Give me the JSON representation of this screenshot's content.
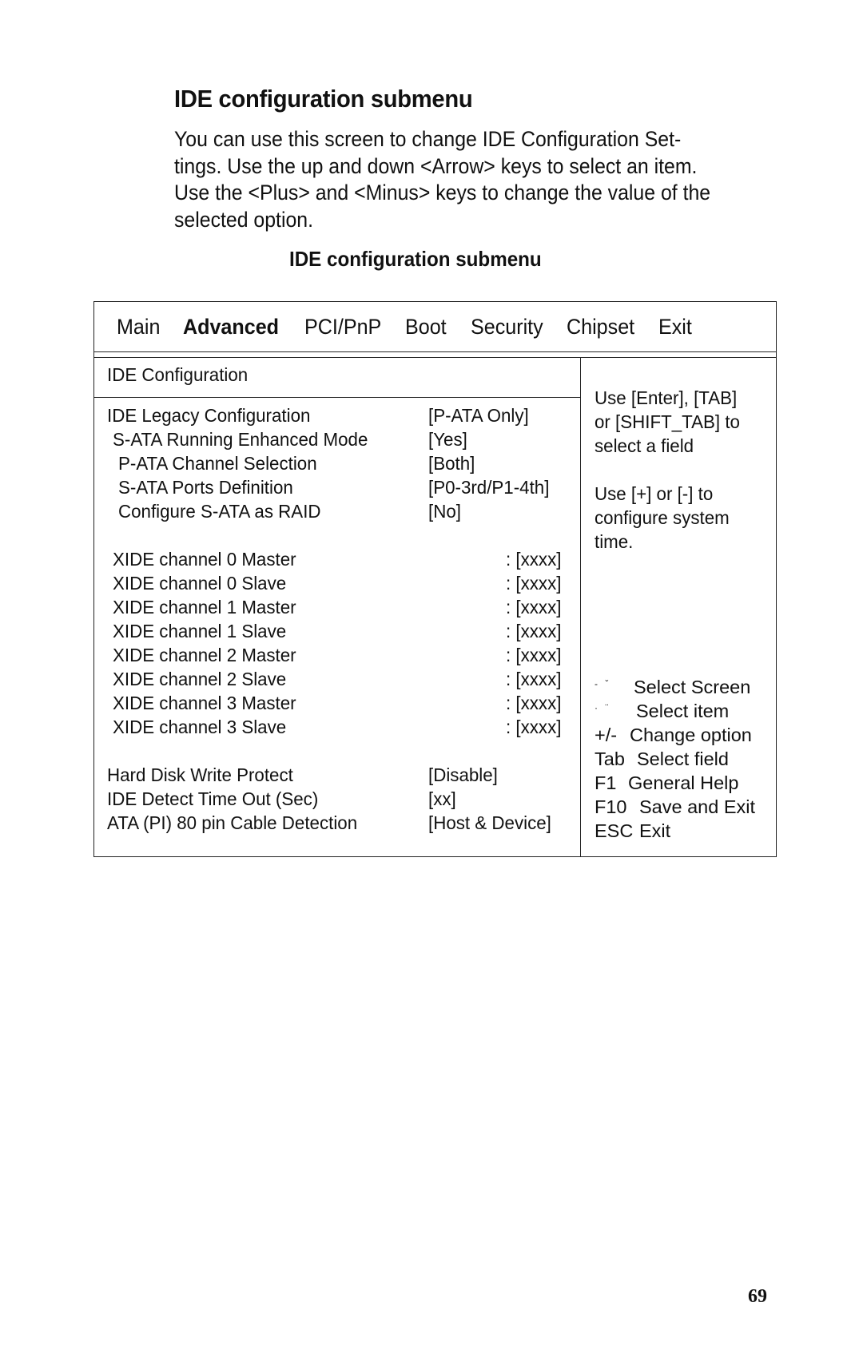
{
  "document": {
    "title": "IDE configuration submenu",
    "intro": "You can use this screen to change IDE Configuration Set-\ntings. Use the up and down <Arrow> keys to select an item.\nUse the <Plus> and <Minus> keys to change the value of the\nselected option.",
    "figure_caption": "IDE configuration submenu",
    "page_number": "69"
  },
  "bios": {
    "menu_tabs": [
      {
        "label": "Main",
        "active": false
      },
      {
        "label": "Advanced",
        "active": true
      },
      {
        "label": "PCI/PnP",
        "active": false
      },
      {
        "label": "Boot",
        "active": false
      },
      {
        "label": "Security",
        "active": false
      },
      {
        "label": "Chipset",
        "active": false
      },
      {
        "label": "Exit",
        "active": false
      }
    ],
    "section_title": "IDE Configuration",
    "settings": [
      {
        "label": "IDE Legacy Configuration",
        "value": "[P-ATA Only]"
      },
      {
        "label": "S-ATA Running Enhanced Mode",
        "value": "[Yes]"
      },
      {
        "label": "P-ATA Channel Selection",
        "value": "[Both]"
      },
      {
        "label": "S-ATA Ports Definition",
        "value": "[P0-3rd/P1-4th]"
      },
      {
        "label": "Configure S-ATA as RAID",
        "value": "[No]"
      }
    ],
    "channels": [
      {
        "label": "XIDE channel 0 Master",
        "value": ": [xxxx]"
      },
      {
        "label": "XIDE channel 0 Slave",
        "value": ": [xxxx]"
      },
      {
        "label": "XIDE channel 1 Master",
        "value": ": [xxxx]"
      },
      {
        "label": "XIDE channel 1 Slave",
        "value": ": [xxxx]"
      },
      {
        "label": "XIDE channel 2 Master",
        "value": ": [xxxx]"
      },
      {
        "label": "XIDE channel 2 Slave",
        "value": ": [xxxx]"
      },
      {
        "label": "XIDE channel 3 Master",
        "value": ": [xxxx]"
      },
      {
        "label": "XIDE channel 3 Slave",
        "value": ": [xxxx]"
      }
    ],
    "misc_settings": [
      {
        "label": "Hard Disk Write Protect",
        "value": "[Disable]"
      },
      {
        "label": "IDE Detect Time Out (Sec)",
        "value": "[xx]"
      },
      {
        "label": "ATA (PI) 80 pin Cable Detection",
        "value": "[Host & Device]"
      }
    ],
    "help": {
      "line1": "Use [Enter], [TAB]",
      "line2": "or [SHIFT_TAB] to",
      "line3": "select a field",
      "line4": "Use [+] or [-] to",
      "line5": "configure system",
      "line6": "time."
    },
    "keys": [
      {
        "key": "- ˇ",
        "icon": "left-right-arrows-icon",
        "action": "Select Screen"
      },
      {
        "key": "· ¨",
        "icon": "up-down-arrows-icon",
        "action": "Select item"
      },
      {
        "key": "+/-",
        "action": "Change option"
      },
      {
        "key": "Tab",
        "action": "Select field"
      },
      {
        "key": "F1",
        "action": "General Help"
      },
      {
        "key": "F10",
        "action": "Save and Exit"
      },
      {
        "key": "ESC",
        "action": "Exit"
      }
    ]
  }
}
